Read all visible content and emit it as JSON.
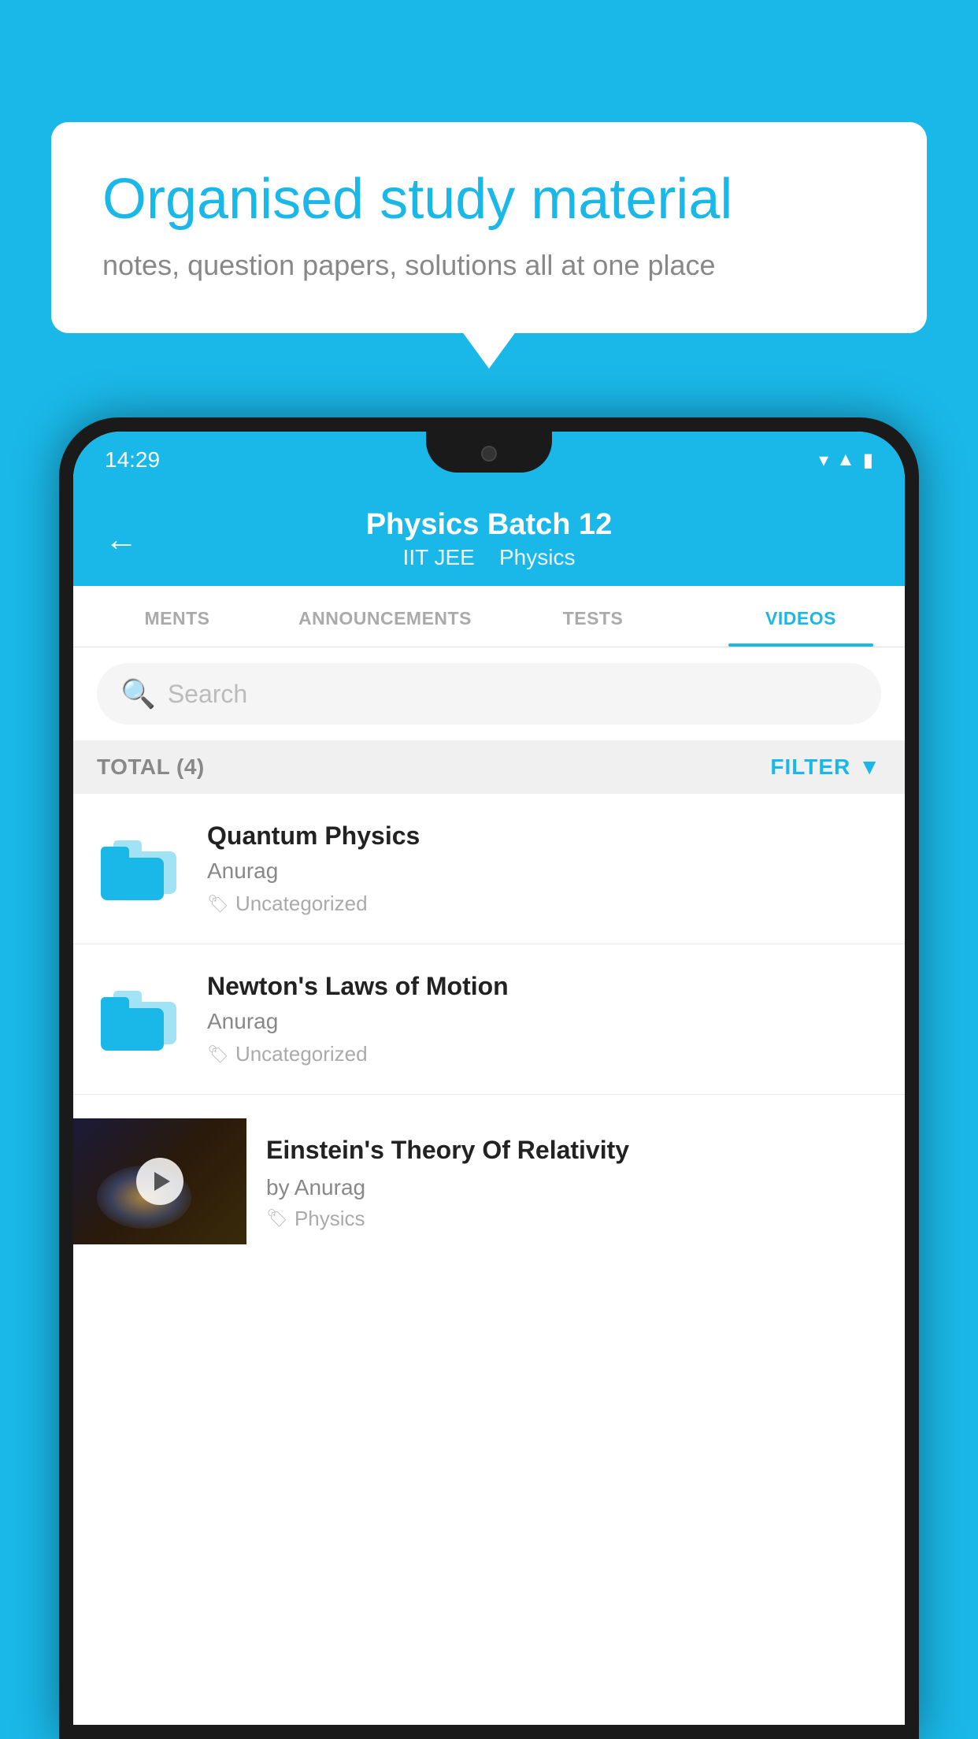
{
  "background_color": "#1ab8e8",
  "speech_bubble": {
    "title": "Organised study material",
    "subtitle": "notes, question papers, solutions all at one place"
  },
  "phone": {
    "status_bar": {
      "time": "14:29",
      "icons": [
        "wifi",
        "signal",
        "battery"
      ]
    },
    "header": {
      "back_label": "←",
      "title": "Physics Batch 12",
      "subtitle_parts": [
        "IIT JEE",
        "Physics"
      ]
    },
    "tabs": [
      {
        "label": "MENTS",
        "active": false
      },
      {
        "label": "ANNOUNCEMENTS",
        "active": false
      },
      {
        "label": "TESTS",
        "active": false
      },
      {
        "label": "VIDEOS",
        "active": true
      }
    ],
    "search": {
      "placeholder": "Search"
    },
    "filter_row": {
      "total_label": "TOTAL (4)",
      "filter_label": "FILTER"
    },
    "videos": [
      {
        "title": "Quantum Physics",
        "author": "Anurag",
        "tag": "Uncategorized",
        "type": "folder"
      },
      {
        "title": "Newton's Laws of Motion",
        "author": "Anurag",
        "tag": "Uncategorized",
        "type": "folder"
      },
      {
        "title": "Einstein's Theory Of Relativity",
        "author": "by Anurag",
        "tag": "Physics",
        "type": "video"
      }
    ]
  }
}
